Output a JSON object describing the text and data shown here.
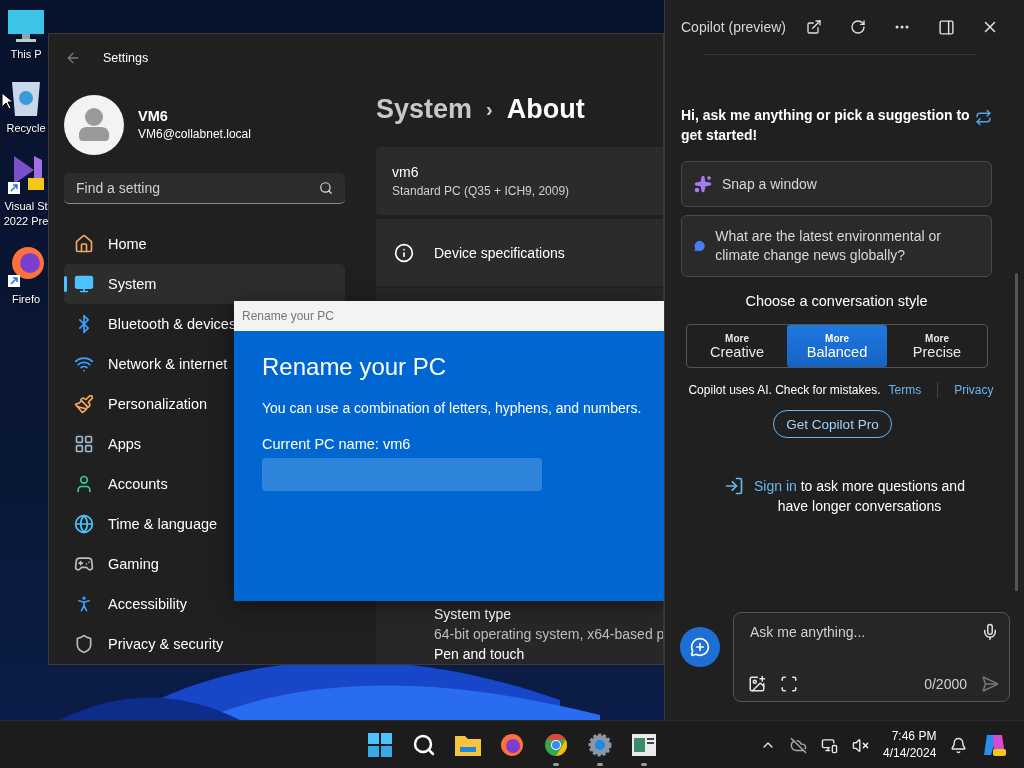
{
  "desktop_icons": [
    {
      "kind": "computer",
      "lines": [
        "This P"
      ]
    },
    {
      "kind": "recycle_bin",
      "lines": [
        "Recycle"
      ]
    },
    {
      "kind": "visual_studio",
      "lines": [
        "Visual St",
        "2022 Pre"
      ]
    },
    {
      "kind": "firefox",
      "lines": [
        "Firefo"
      ]
    }
  ],
  "settings": {
    "title": "Settings",
    "user": {
      "name": "VM6",
      "email": "VM6@collabnet.local"
    },
    "search": {
      "placeholder": "Find a setting"
    },
    "nav": [
      {
        "label": "Home",
        "selected": false
      },
      {
        "label": "System",
        "selected": true
      },
      {
        "label": "Bluetooth & devices",
        "selected": false
      },
      {
        "label": "Network & internet",
        "selected": false
      },
      {
        "label": "Personalization",
        "selected": false
      },
      {
        "label": "Apps",
        "selected": false
      },
      {
        "label": "Accounts",
        "selected": false
      },
      {
        "label": "Time & language",
        "selected": false
      },
      {
        "label": "Gaming",
        "selected": false
      },
      {
        "label": "Accessibility",
        "selected": false
      },
      {
        "label": "Privacy & security",
        "selected": false
      }
    ],
    "breadcrumb": {
      "parent": "System",
      "separator": "›",
      "current": "About"
    },
    "device": {
      "name": "vm6",
      "model": "Standard PC (Q35 + ICH9, 2009)"
    },
    "spec_header": "Device specifications",
    "specs": [
      {
        "label": "System type",
        "value": "64-bit operating system, x64-based p"
      },
      {
        "label": "Pen and touch"
      }
    ]
  },
  "rename_dialog": {
    "title": "Rename your PC",
    "heading": "Rename your PC",
    "description": "You can use a combination of letters, hyphens, and numbers.",
    "current_name": "Current PC name: vm6"
  },
  "copilot": {
    "title": "Copilot (preview)",
    "greeting": "Hi, ask me anything or pick a suggestion to get started!",
    "suggestions": [
      {
        "kind": "sparkle",
        "text": "Snap a window"
      },
      {
        "kind": "bubble",
        "text": "What are the latest environmental or climate change news globally?"
      }
    ],
    "style_heading": "Choose a conversation style",
    "styles": [
      {
        "prefix": "More",
        "label": "Creative",
        "selected": false
      },
      {
        "prefix": "More",
        "label": "Balanced",
        "selected": true
      },
      {
        "prefix": "More",
        "label": "Precise",
        "selected": false
      }
    ],
    "disclaimer": "Copilot uses AI. Check for mistakes.",
    "links": [
      "Terms",
      "Privacy"
    ],
    "pro_button": "Get Copilot Pro",
    "sign_in": {
      "link": "Sign in",
      "text": " to ask more questions and have longer conversations"
    },
    "input": {
      "placeholder": "Ask me anything...",
      "counter": "0/2000"
    }
  },
  "taskbar": {
    "apps": [
      {
        "kind": "start",
        "running": false
      },
      {
        "kind": "search",
        "running": false
      },
      {
        "kind": "explorer",
        "running": false
      },
      {
        "kind": "firefox",
        "running": false
      },
      {
        "kind": "chrome",
        "running": true
      },
      {
        "kind": "settings",
        "running": true
      },
      {
        "kind": "app",
        "running": true
      }
    ],
    "time": "7:46 PM",
    "date": "4/14/2024"
  }
}
